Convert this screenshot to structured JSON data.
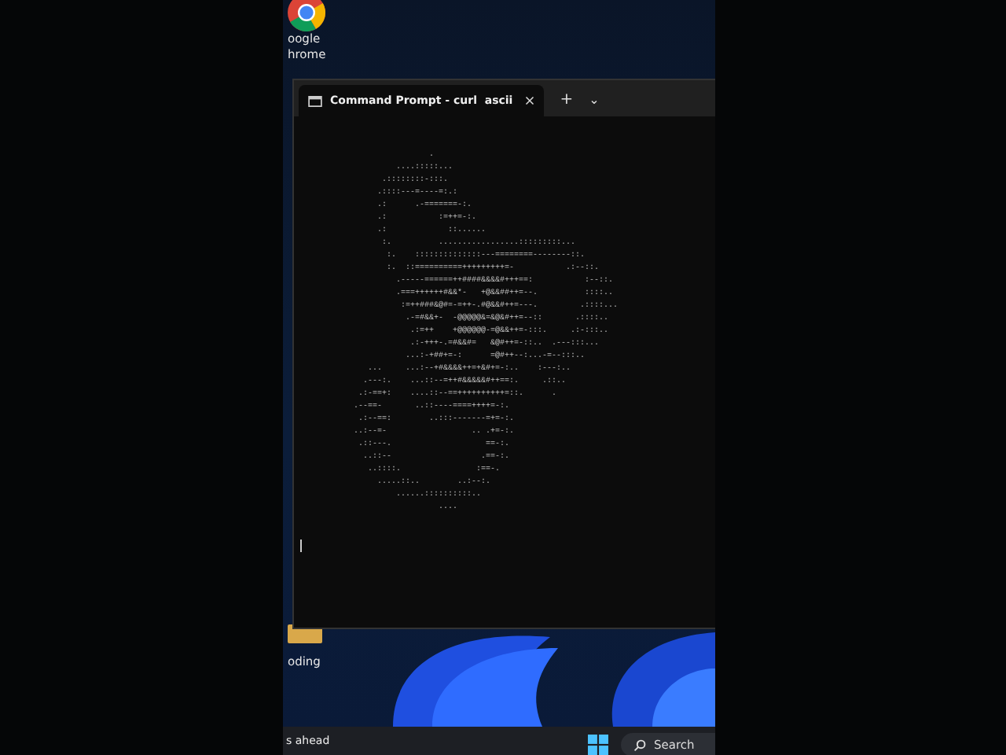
{
  "desktop": {
    "icons": [
      {
        "kind": "browser",
        "label_lines": [
          "oogle",
          "hrome"
        ]
      },
      {
        "kind": "folder",
        "label_lines": [
          "oding"
        ]
      }
    ]
  },
  "window": {
    "tabs": [
      {
        "title": "Command Prompt - curl  ascii",
        "selected": true
      }
    ],
    "new_tab": "+",
    "dropdown": "⌄",
    "terminal": {
      "lines": [
        "                  .",
        "           ....:::::...",
        "        .::::::::-:::.",
        "       .::::---=----=:.:",
        "       .:      .-=======-:.",
        "       .:           :=++=-:.",
        "       .:             ::......",
        "        :.          .................:::::::::...",
        "         :.    ::::::::::::::---========--------::.",
        "         :.  ::==========+++++++++=-           .:--::.",
        "           .-----======++####&&&&#+++==:           :--::.",
        "           .===++++++#&&*-   +@&&##++=--.          ::::..",
        "            :=++###&@#=-=++-.#@&&#++=---.         .::::...",
        "             .-=#&&+-  -@@@@@&=&@&#++=--::       .::::..",
        "              .:=++    +@@@@@@-=@&&++=-:::.     .:-:::..",
        "              .:-+++-.=#&&#=   &@#++=-::..  .---:::...",
        "             ...:-+##+=-:      =@#++--:...-=--:::..",
        "     ...     ...:--+#&&&&++=+&#+=-:..    :---:..",
        "    .---:.    ...::--=++#&&&&&#++==:.     .::..",
        "   .:-==+:    ....::--==++++++++++=::.      .",
        "  .--==-       ..::----====++++=-:.",
        "   .:--==:        ..:::-------=+=-:.",
        "  ..:--=-                  .. .+=-:.",
        "   .::---.                    ==-:.",
        "    ..::--                   .==-:.",
        "     ..::::.                :==-.",
        "       .....::..        ..:--:.",
        "           ......::::::::::..",
        "                    ...."
      ],
      "cursor": true
    }
  },
  "taskbar": {
    "news": "s ahead",
    "search": {
      "placeholder": "Search"
    }
  }
}
